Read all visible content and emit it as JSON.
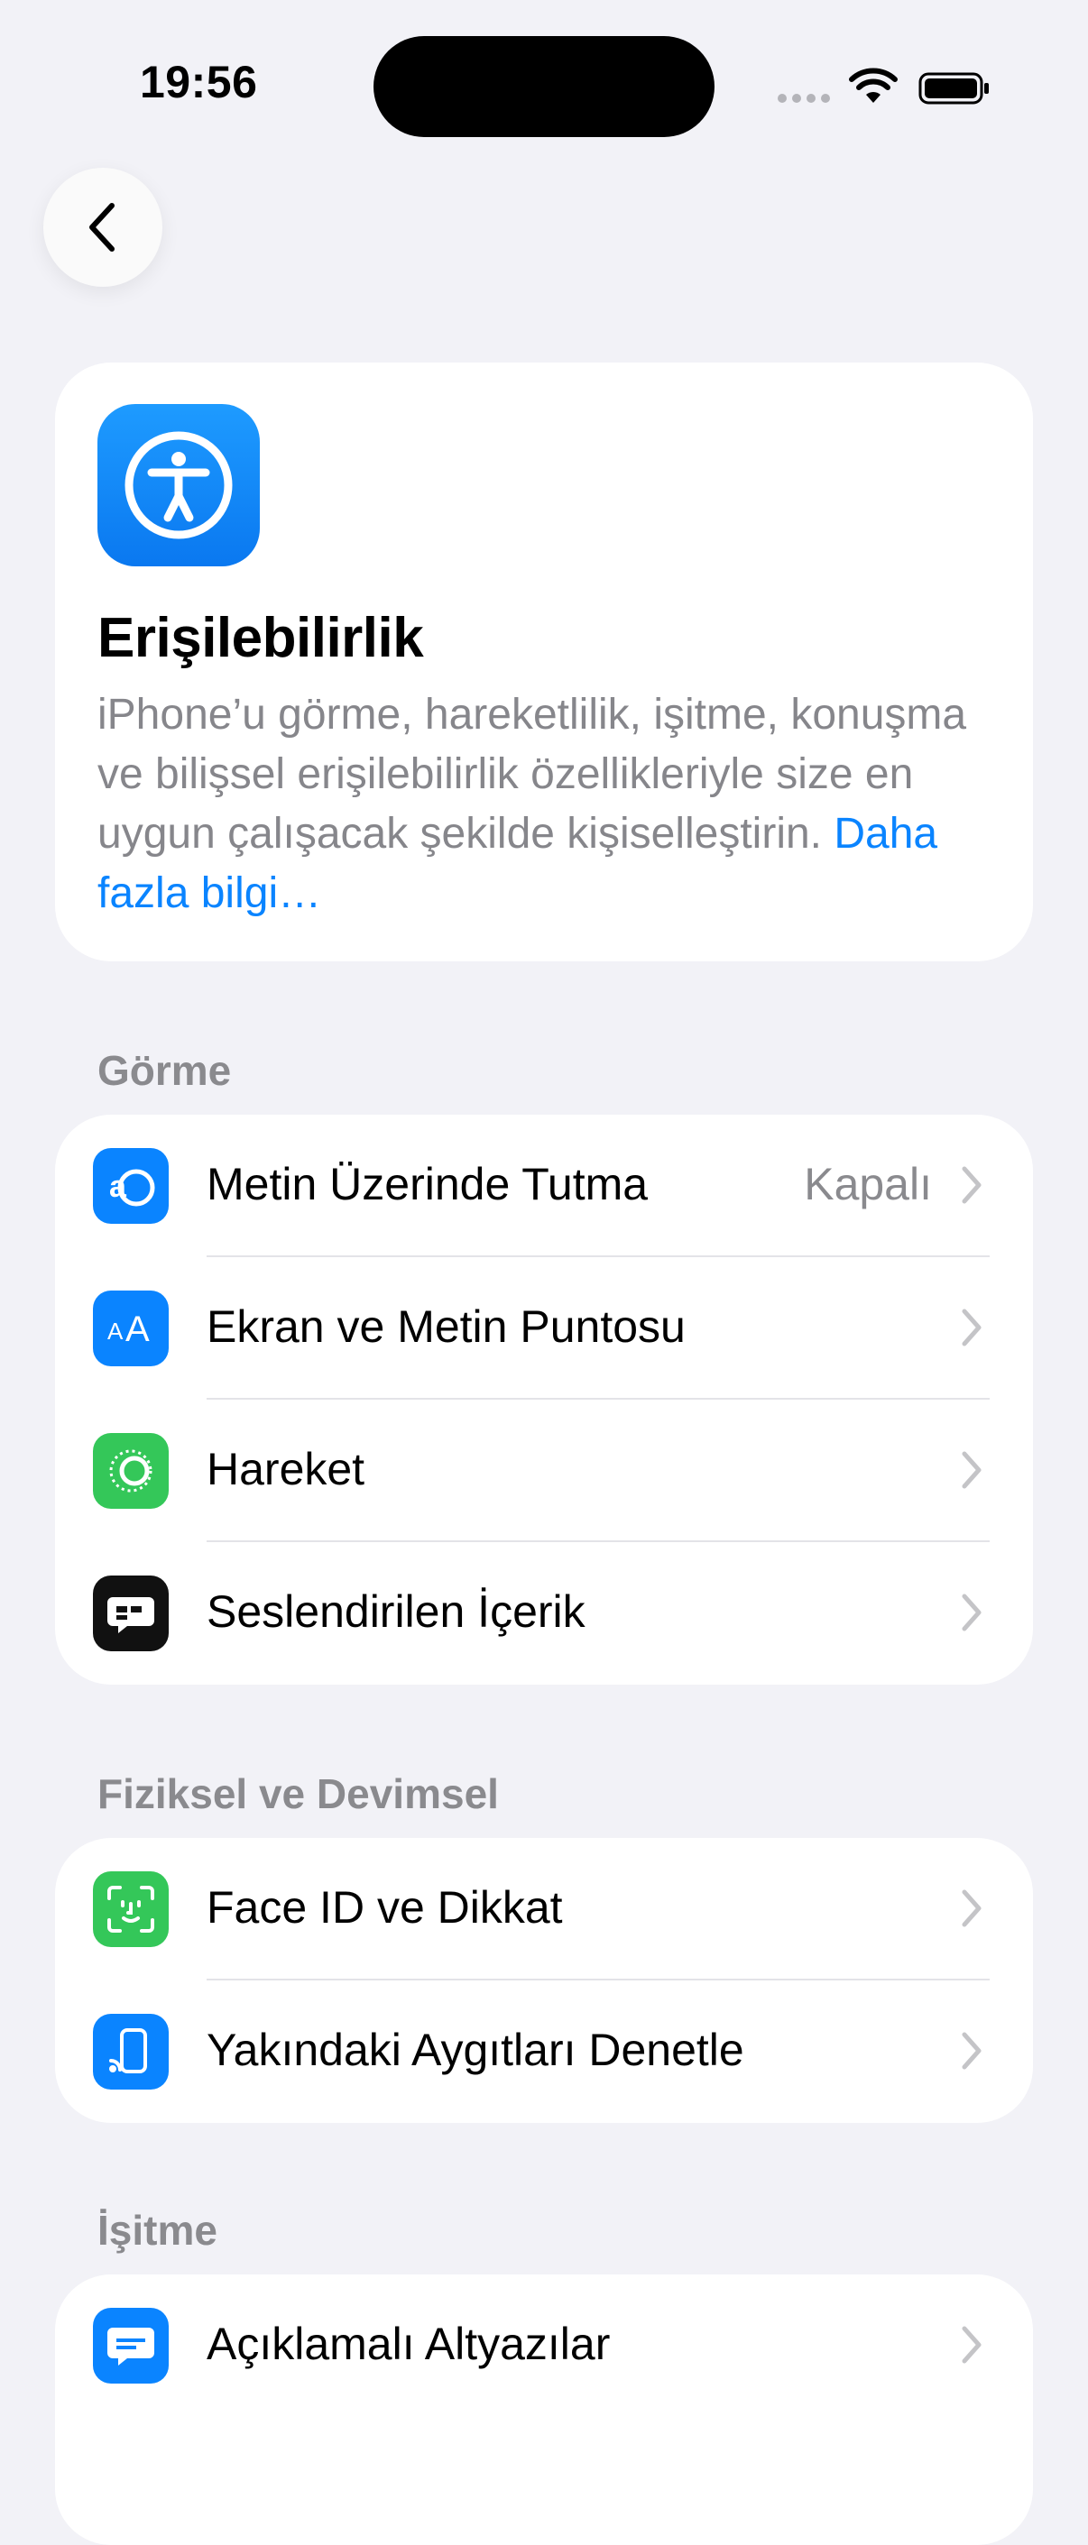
{
  "status_bar": {
    "time": "19:56"
  },
  "nav": {
    "back": "back"
  },
  "header": {
    "title": "Erişilebilirlik",
    "description": "iPhone’u görme, hareketlilik, işitme, konuşma ve bilişsel erişilebilirlik özellikleriyle size en uygun çalışacak şekilde kişiselleştirin.",
    "link": "Daha fazla bilgi…",
    "icon": "accessibility-icon",
    "icon_color": "#0a84ff"
  },
  "sections": [
    {
      "title": "Görme",
      "items": [
        {
          "label": "Metin Üzerinde Tutma",
          "value": "Kapalı",
          "icon": "hover-text-icon",
          "color": "#0a84ff"
        },
        {
          "label": "Ekran ve Metin Puntosu",
          "value": "",
          "icon": "text-size-icon",
          "color": "#0a84ff"
        },
        {
          "label": "Hareket",
          "value": "",
          "icon": "motion-icon",
          "color": "#34c759"
        },
        {
          "label": "Seslendirilen İçerik",
          "value": "",
          "icon": "spoken-content-icon",
          "color": "#111111"
        }
      ]
    },
    {
      "title": "Fiziksel ve Devimsel",
      "items": [
        {
          "label": "Face ID ve Dikkat",
          "value": "",
          "icon": "face-id-icon",
          "color": "#34c759"
        },
        {
          "label": "Yakındaki Aygıtları Denetle",
          "value": "",
          "icon": "nearby-devices-icon",
          "color": "#0a84ff"
        }
      ]
    },
    {
      "title": "İşitme",
      "items": [
        {
          "label": "Açıklamalı Altyazılar",
          "value": "",
          "icon": "subtitles-icon",
          "color": "#0a84ff"
        }
      ]
    }
  ]
}
